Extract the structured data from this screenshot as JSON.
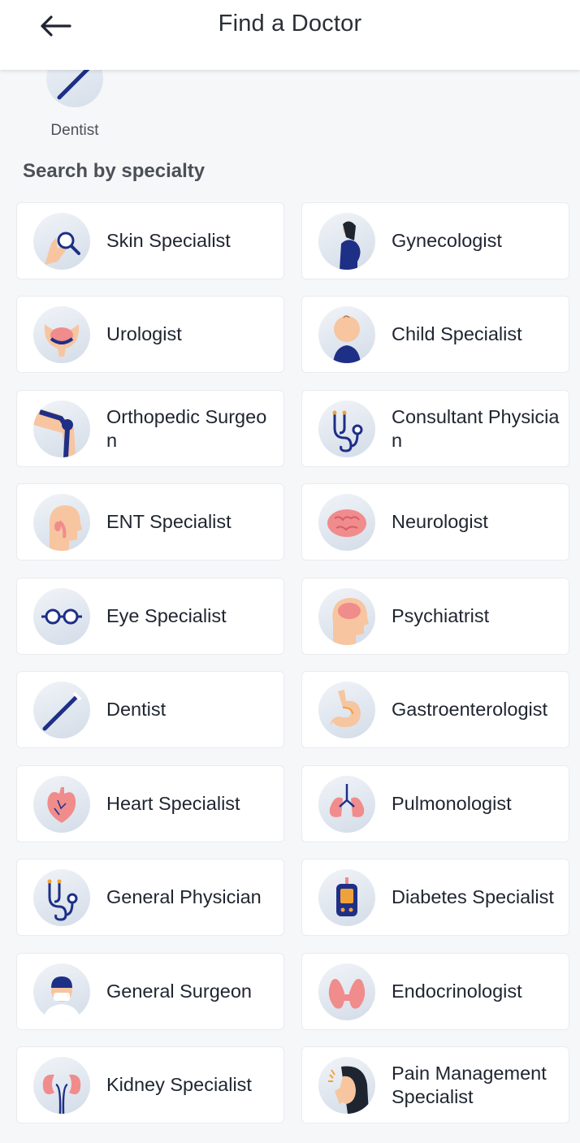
{
  "header": {
    "title": "Find a Doctor",
    "back_icon": "arrow-left-icon"
  },
  "recent": {
    "label": "Dentist",
    "icon": "toothbrush-icon"
  },
  "section": {
    "title": "Search by specialty"
  },
  "colors": {
    "navy": "#1e2f86",
    "skin": "#f7c59f",
    "pink": "#f08c8c",
    "accent": "#f0a23a"
  },
  "specialties": [
    {
      "label": "Skin Specialist",
      "icon": "magnifier-hand-icon"
    },
    {
      "label": "Gynecologist",
      "icon": "pregnant-woman-icon"
    },
    {
      "label": "Urologist",
      "icon": "bladder-icon"
    },
    {
      "label": "Child Specialist",
      "icon": "baby-icon"
    },
    {
      "label": "Orthopedic Surgeon",
      "icon": "knee-joint-icon"
    },
    {
      "label": "Consultant Physician",
      "icon": "stethoscope-icon"
    },
    {
      "label": "ENT Specialist",
      "icon": "ent-head-icon"
    },
    {
      "label": "Neurologist",
      "icon": "brain-icon"
    },
    {
      "label": "Eye Specialist",
      "icon": "glasses-icon"
    },
    {
      "label": "Psychiatrist",
      "icon": "head-brain-icon"
    },
    {
      "label": "Dentist",
      "icon": "toothbrush-icon"
    },
    {
      "label": "Gastroenterologist",
      "icon": "stomach-icon"
    },
    {
      "label": "Heart Specialist",
      "icon": "heart-icon"
    },
    {
      "label": "Pulmonologist",
      "icon": "lungs-icon"
    },
    {
      "label": "General Physician",
      "icon": "stethoscope-icon"
    },
    {
      "label": "Diabetes Specialist",
      "icon": "glucometer-icon"
    },
    {
      "label": "General Surgeon",
      "icon": "surgeon-icon"
    },
    {
      "label": "Endocrinologist",
      "icon": "thyroid-icon"
    },
    {
      "label": "Kidney Specialist",
      "icon": "kidneys-icon"
    },
    {
      "label": "Pain Management Specialist",
      "icon": "headache-woman-icon"
    }
  ]
}
